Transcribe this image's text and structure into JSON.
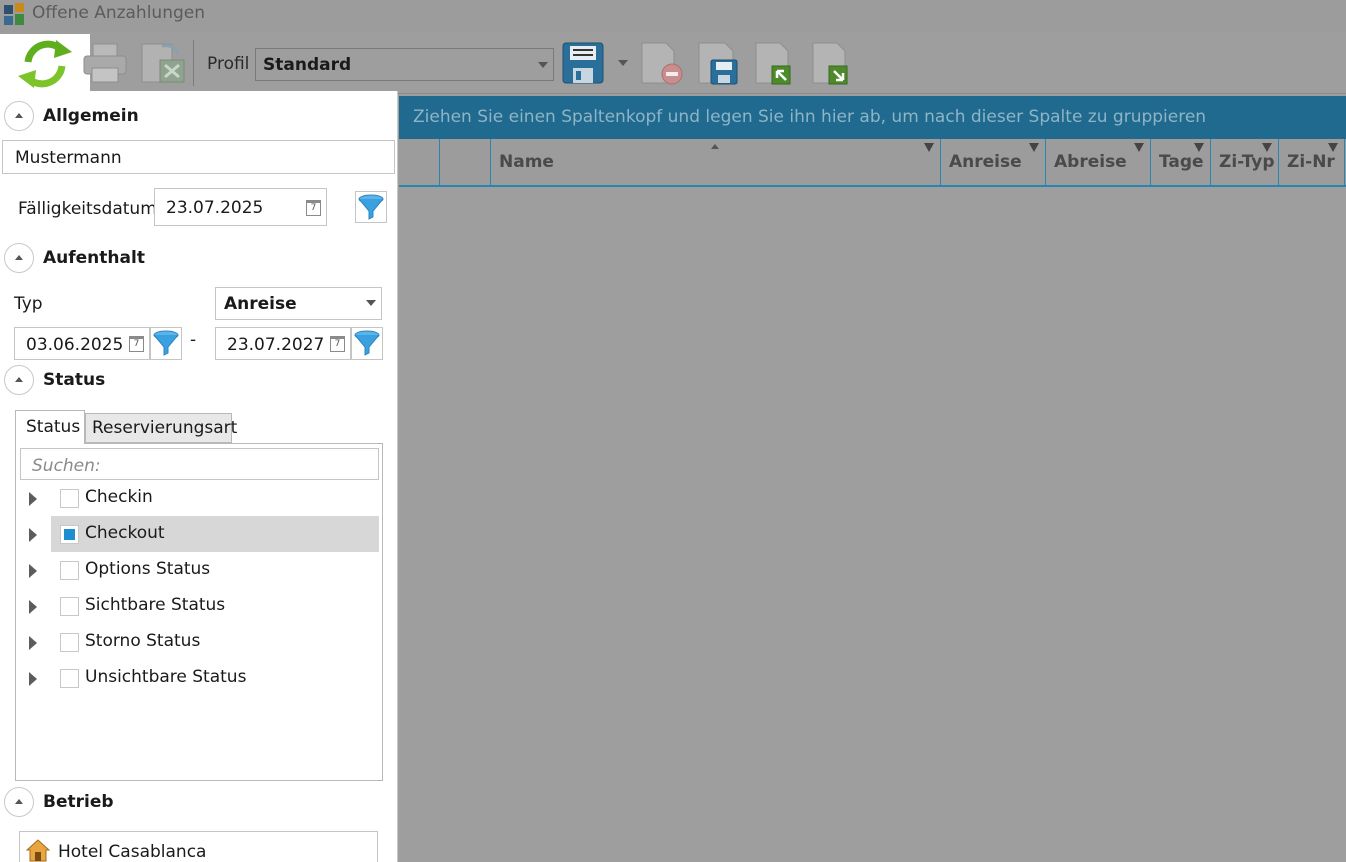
{
  "window": {
    "title": "Offene Anzahlungen"
  },
  "toolbar": {
    "profil_label": "Profil",
    "profil_value": "Standard",
    "icons": [
      "refresh-icon",
      "print-icon",
      "export-excel-icon",
      "save-icon",
      "save-dropdown-icon",
      "delete-document-icon",
      "save-as-icon",
      "import-icon",
      "export-icon"
    ]
  },
  "allgemein": {
    "title": "Allgemein",
    "name_value": "Mustermann",
    "due_label": "Fälligkeitsdatum",
    "due_value": "23.07.2025"
  },
  "aufenthalt": {
    "title": "Aufenthalt",
    "typ_label": "Typ",
    "typ_value": "Anreise",
    "from_date": "03.06.2025",
    "separator": "-",
    "to_date": "23.07.2027"
  },
  "status": {
    "title": "Status",
    "tabs": [
      "Status",
      "Reservierungsart"
    ],
    "search_placeholder": "Suchen:",
    "items": [
      {
        "label": "Checkin",
        "checked": false
      },
      {
        "label": "Checkout",
        "checked": true
      },
      {
        "label": "Options Status",
        "checked": false
      },
      {
        "label": "Sichtbare Status",
        "checked": false
      },
      {
        "label": "Storno Status",
        "checked": false
      },
      {
        "label": "Unsichtbare Status",
        "checked": false
      }
    ]
  },
  "betrieb": {
    "title": "Betrieb",
    "hotel": "Hotel Casablanca"
  },
  "grid": {
    "group_hint": "Ziehen Sie einen Spaltenkopf und legen Sie ihn hier ab, um nach dieser Spalte zu gruppieren",
    "columns": [
      "Name",
      "Anreise",
      "Abreise",
      "Tage",
      "Zi-Typ",
      "Zi-Nr"
    ]
  },
  "colors": {
    "accent": "#1f6a8e",
    "checked": "#1e8ed1",
    "funnel": "#3aa0e0"
  }
}
